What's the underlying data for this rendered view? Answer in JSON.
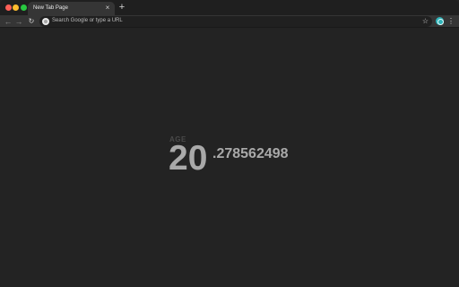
{
  "window": {
    "controls": [
      "close",
      "minimize",
      "maximize"
    ]
  },
  "tabs": [
    {
      "title": "New Tab Page",
      "close_icon": "×"
    }
  ],
  "new_tab_icon": "+",
  "toolbar": {
    "back_icon": "←",
    "forward_icon": "→",
    "reload_icon": "↻",
    "omnibox_placeholder": "Search Google or type a URL",
    "star_icon": "☆",
    "menu_icon": "⋮"
  },
  "age": {
    "label": "AGE",
    "integer": "20",
    "fraction": ".278562498"
  },
  "colors": {
    "background": "#232323",
    "text": "#a9a9a9",
    "label": "#4a4a4a",
    "profile": "#2fb3b8"
  }
}
